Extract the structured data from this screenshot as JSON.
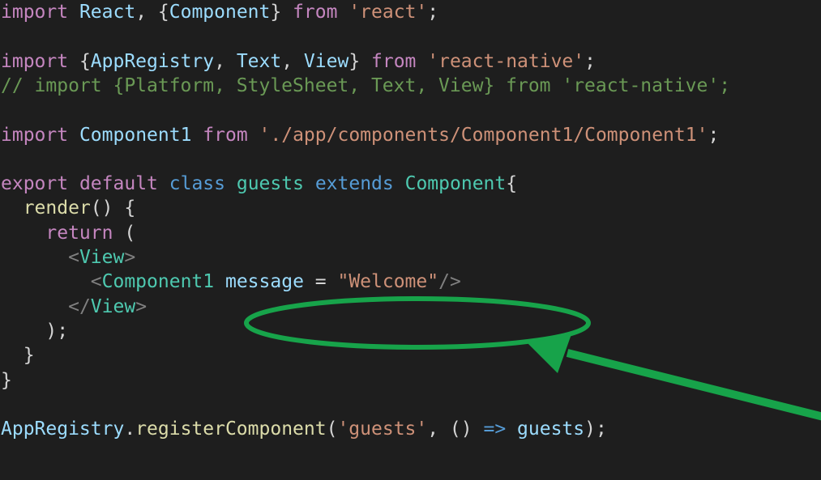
{
  "colors": {
    "background": "#1e1e1e",
    "keyword_control": "#c586c0",
    "keyword": "#569cd6",
    "identifier": "#9cdcfe",
    "type": "#4ec9b0",
    "function": "#dcdcaa",
    "string": "#ce9178",
    "comment": "#6a9955",
    "punctuation": "#d4d4d4",
    "tag_bracket": "#808080",
    "annotation": "#17a34a"
  },
  "code_lines": [
    [
      [
        "import",
        "keyword_control"
      ],
      [
        " ",
        "punctuation"
      ],
      [
        "React",
        "identifier"
      ],
      [
        ", {",
        "punctuation"
      ],
      [
        "Component",
        "identifier"
      ],
      [
        "} ",
        "punctuation"
      ],
      [
        "from",
        "keyword_control"
      ],
      [
        " ",
        "punctuation"
      ],
      [
        "'react'",
        "string"
      ],
      [
        ";",
        "punctuation"
      ]
    ],
    [],
    [
      [
        "import",
        "keyword_control"
      ],
      [
        " {",
        "punctuation"
      ],
      [
        "AppRegistry",
        "identifier"
      ],
      [
        ", ",
        "punctuation"
      ],
      [
        "Text",
        "identifier"
      ],
      [
        ", ",
        "punctuation"
      ],
      [
        "View",
        "identifier"
      ],
      [
        "} ",
        "punctuation"
      ],
      [
        "from",
        "keyword_control"
      ],
      [
        " ",
        "punctuation"
      ],
      [
        "'react-native'",
        "string"
      ],
      [
        ";",
        "punctuation"
      ]
    ],
    [
      [
        "// import {Platform, StyleSheet, Text, View} from 'react-native';",
        "comment"
      ]
    ],
    [],
    [
      [
        "import",
        "keyword_control"
      ],
      [
        " ",
        "punctuation"
      ],
      [
        "Component1",
        "identifier"
      ],
      [
        " ",
        "punctuation"
      ],
      [
        "from",
        "keyword_control"
      ],
      [
        " ",
        "punctuation"
      ],
      [
        "'./app/components/Component1/Component1'",
        "string"
      ],
      [
        ";",
        "punctuation"
      ]
    ],
    [],
    [
      [
        "export",
        "keyword_control"
      ],
      [
        " ",
        "punctuation"
      ],
      [
        "default",
        "keyword_control"
      ],
      [
        " ",
        "punctuation"
      ],
      [
        "class",
        "keyword"
      ],
      [
        " ",
        "punctuation"
      ],
      [
        "guests",
        "type"
      ],
      [
        " ",
        "punctuation"
      ],
      [
        "extends",
        "keyword"
      ],
      [
        " ",
        "punctuation"
      ],
      [
        "Component",
        "type"
      ],
      [
        "{",
        "punctuation"
      ]
    ],
    [
      [
        "  ",
        "punctuation"
      ],
      [
        "render",
        "function"
      ],
      [
        "() {",
        "punctuation"
      ]
    ],
    [
      [
        "    ",
        "punctuation"
      ],
      [
        "return",
        "keyword_control"
      ],
      [
        " (",
        "punctuation"
      ]
    ],
    [
      [
        "      ",
        "punctuation"
      ],
      [
        "<",
        "tag_bracket"
      ],
      [
        "View",
        "type"
      ],
      [
        ">",
        "tag_bracket"
      ]
    ],
    [
      [
        "        ",
        "punctuation"
      ],
      [
        "<",
        "tag_bracket"
      ],
      [
        "Component1",
        "type"
      ],
      [
        " ",
        "punctuation"
      ],
      [
        "message",
        "identifier"
      ],
      [
        " = ",
        "punctuation"
      ],
      [
        "\"Welcome\"",
        "string"
      ],
      [
        "/>",
        "tag_bracket"
      ]
    ],
    [
      [
        "      ",
        "punctuation"
      ],
      [
        "</",
        "tag_bracket"
      ],
      [
        "View",
        "type"
      ],
      [
        ">",
        "tag_bracket"
      ]
    ],
    [
      [
        "    );",
        "punctuation"
      ]
    ],
    [
      [
        "  }",
        "punctuation"
      ]
    ],
    [
      [
        "}",
        "punctuation"
      ]
    ],
    [],
    [
      [
        "AppRegistry",
        "identifier"
      ],
      [
        ".",
        "punctuation"
      ],
      [
        "registerComponent",
        "function"
      ],
      [
        "(",
        "punctuation"
      ],
      [
        "'guests'",
        "string"
      ],
      [
        ", () ",
        "punctuation"
      ],
      [
        "=>",
        "keyword"
      ],
      [
        " ",
        "punctuation"
      ],
      [
        "guests",
        "identifier"
      ],
      [
        ");",
        "punctuation"
      ]
    ]
  ]
}
